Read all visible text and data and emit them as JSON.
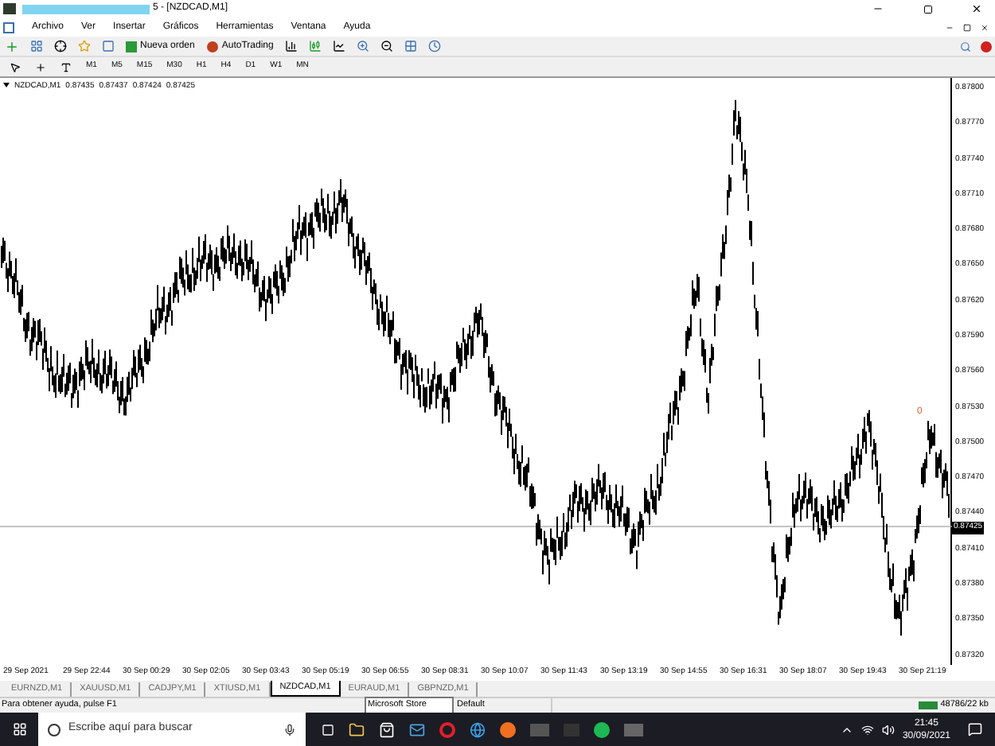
{
  "window": {
    "title": "5 - [NZDCAD,M1]"
  },
  "menu": [
    "Archivo",
    "Ver",
    "Insertar",
    "Gráficos",
    "Herramientas",
    "Ventana",
    "Ayuda"
  ],
  "toolbar": {
    "buttons": [
      {
        "label": "Nueva orden"
      },
      {
        "label": "AutoTrading"
      }
    ]
  },
  "timeframes": [
    "M1",
    "M5",
    "M15",
    "M30",
    "H1",
    "H4",
    "D1",
    "W1",
    "MN"
  ],
  "chart": {
    "symbol": "NZDCAD,M1",
    "ohlc": [
      "0.87435",
      "0.87437",
      "0.87424",
      "0.87425"
    ],
    "price_labels": [
      "0.87800",
      "0.87770",
      "0.87740",
      "0.87710",
      "0.87680",
      "0.87650",
      "0.87620",
      "0.87590",
      "0.87560",
      "0.87530",
      "0.87500",
      "0.87470",
      "0.87440",
      "0.87410",
      "0.87380",
      "0.87350",
      "0.87320"
    ],
    "current_price": "0.87425",
    "marker": "0",
    "time_labels": [
      "29 Sep 2021",
      "29 Sep 22:44",
      "30 Sep 00:29",
      "30 Sep 02:05",
      "30 Sep 03:43",
      "30 Sep 05:19",
      "30 Sep 06:55",
      "30 Sep 08:31",
      "30 Sep 10:07",
      "30 Sep 11:43",
      "30 Sep 13:19",
      "30 Sep 14:55",
      "30 Sep 16:31",
      "30 Sep 18:07",
      "30 Sep 19:43",
      "30 Sep 21:19"
    ]
  },
  "tabs": [
    {
      "label": "EURNZD,M1",
      "selected": false
    },
    {
      "label": "XAUUSD,M1",
      "selected": false
    },
    {
      "label": "CADJPY,M1",
      "selected": false
    },
    {
      "label": "XTIUSD,M1",
      "selected": false
    },
    {
      "label": "NZDCAD,M1",
      "selected": true
    },
    {
      "label": "EURAUD,M1",
      "selected": false
    },
    {
      "label": "GBPNZD,M1",
      "selected": false
    }
  ],
  "status_bar": {
    "help": "Para obtener ayuda, pulse F1",
    "tooltip": "Microsoft Store",
    "profile": "Default",
    "traffic": "48786/22 kb"
  },
  "taskbar": {
    "search_placeholder": "Escribe aquí para buscar",
    "time": "21:45",
    "date": "30/09/2021"
  }
}
